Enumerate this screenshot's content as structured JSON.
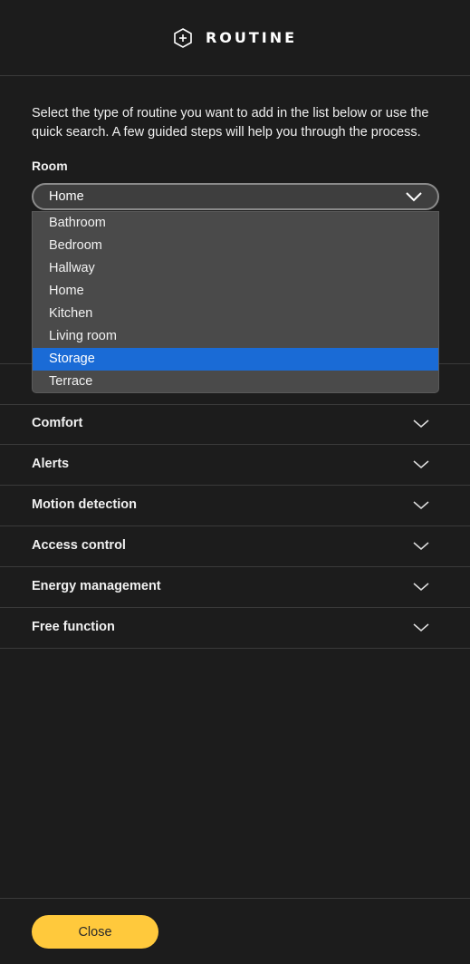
{
  "header": {
    "title": "ROUTINE",
    "icon": "add-hexagon-icon"
  },
  "intro": "Select the type of routine you want to add in the list below or use the quick search. A few guided steps will help you through the process.",
  "room": {
    "label": "Room",
    "selected_value": "Home",
    "options": [
      "Bathroom",
      "Bedroom",
      "Hallway",
      "Home",
      "Kitchen",
      "Living room",
      "Storage",
      "Terrace"
    ],
    "highlighted_option": "Storage",
    "highlight_color": "#1a6bd6"
  },
  "categories": [
    {
      "label": "Comfort"
    },
    {
      "label": "Alerts"
    },
    {
      "label": "Motion detection"
    },
    {
      "label": "Access control"
    },
    {
      "label": "Energy management"
    },
    {
      "label": "Free function"
    }
  ],
  "footer": {
    "close_label": "Close",
    "close_color": "#ffc93c"
  },
  "colors": {
    "background": "#1c1c1c",
    "divider": "#3a3a3a",
    "dropdown_bg": "#4a4a4a"
  }
}
